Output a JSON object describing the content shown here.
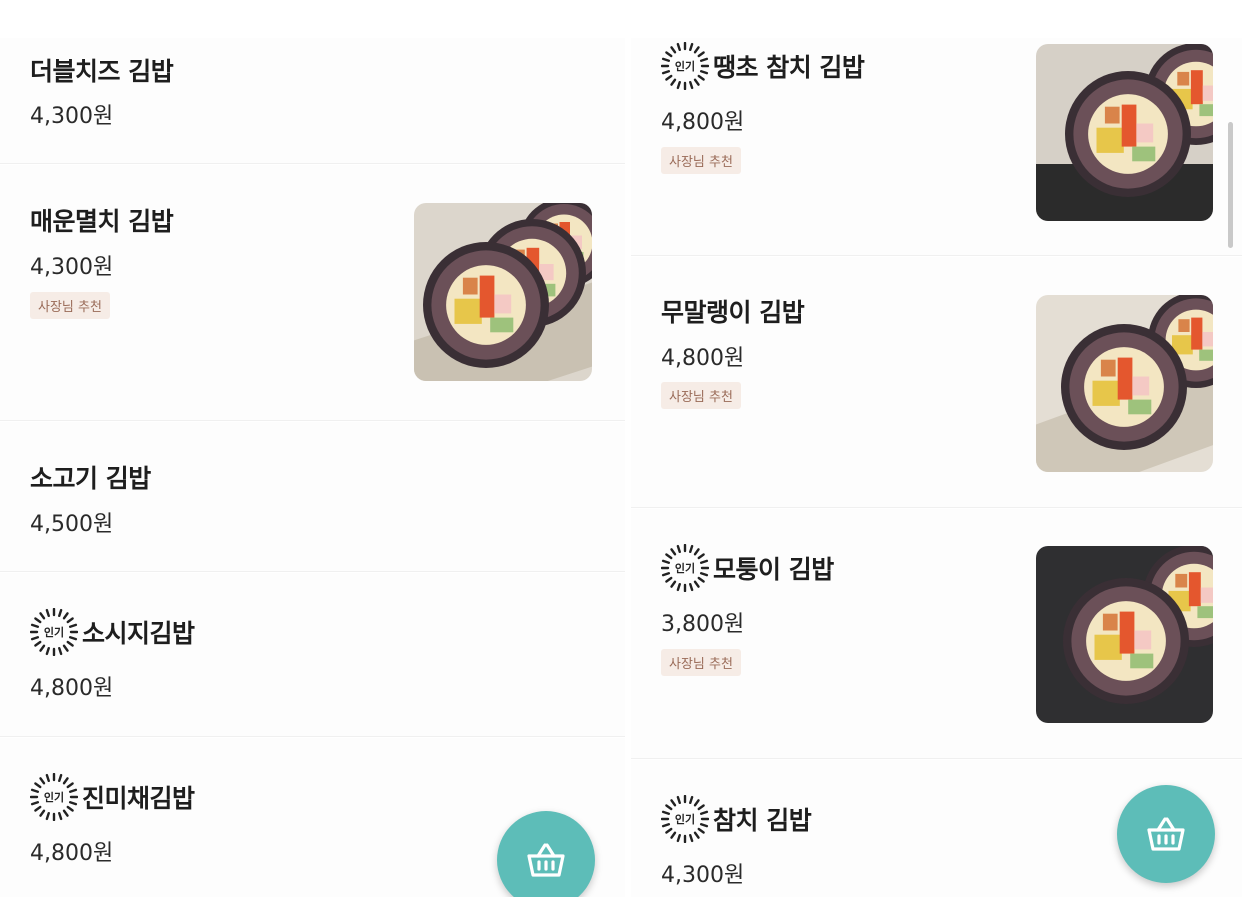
{
  "left": {
    "items": [
      {
        "name": "더블치즈 김밥",
        "price": "4,300원",
        "popular": false,
        "tag": null
      },
      {
        "name": "매운멸치 김밥",
        "price": "4,300원",
        "popular": false,
        "tag": "사장님 추천"
      },
      {
        "name": "소고기 김밥",
        "price": "4,500원",
        "popular": false,
        "tag": null
      },
      {
        "name": "소시지김밥",
        "price": "4,800원",
        "popular": true,
        "tag": null
      },
      {
        "name": "진미채김밥",
        "price": "4,800원",
        "popular": true,
        "tag": null
      }
    ]
  },
  "right": {
    "items": [
      {
        "name": "땡초 참치 김밥",
        "price": "4,800원",
        "popular": true,
        "tag": "사장님 추천"
      },
      {
        "name": "무말랭이 김밥",
        "price": "4,800원",
        "popular": false,
        "tag": "사장님 추천"
      },
      {
        "name": "모퉁이 김밥",
        "price": "3,800원",
        "popular": true,
        "tag": "사장님 추천"
      },
      {
        "name": "참치 김밥",
        "price": "4,300원",
        "popular": true,
        "tag": null
      }
    ]
  },
  "popular_label": "인기",
  "fab_icon": "shopping-basket-icon",
  "colors": {
    "accent": "#5dbdb8",
    "tag_bg": "#f6ece6",
    "tag_text": "#9a6b58",
    "text": "#1e1e1e"
  }
}
